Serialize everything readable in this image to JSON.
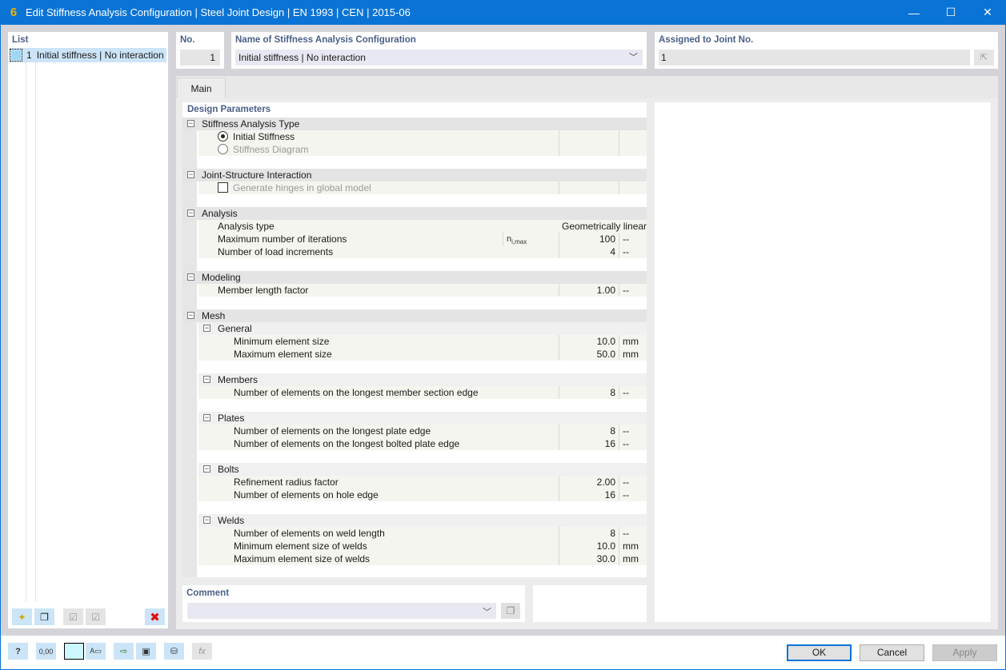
{
  "window": {
    "title": "Edit Stiffness Analysis Configuration | Steel Joint Design | EN 1993 | CEN | 2015-06",
    "app_icon": "rfem-app-icon",
    "controls": {
      "minimize": "—",
      "maximize": "☐",
      "close": "✕"
    }
  },
  "list": {
    "label": "List",
    "items": [
      {
        "number": "1",
        "name": "Initial stiffness | No interaction",
        "color": "#9fd7f3"
      }
    ],
    "toolbar": [
      {
        "name": "new-item-icon",
        "glyph": "✦",
        "enabled": true
      },
      {
        "name": "copy-item-icon",
        "glyph": "❐",
        "enabled": true
      },
      {
        "name": "check-all-icon",
        "glyph": "☑",
        "enabled": false
      },
      {
        "name": "toggle-check-icon",
        "glyph": "☑",
        "enabled": false
      },
      {
        "name": "delete-icon",
        "glyph": "✖",
        "enabled": true
      }
    ]
  },
  "header": {
    "no_label": "No.",
    "no_value": "1",
    "name_label": "Name of Stiffness Analysis Configuration",
    "name_value": "Initial stiffness | No interaction",
    "assigned_label": "Assigned to Joint No.",
    "assigned_value": "1"
  },
  "tabs": [
    {
      "label": "Main",
      "active": true
    }
  ],
  "design_parameters": {
    "title": "Design Parameters",
    "stiffness_type": {
      "label": "Stiffness Analysis Type",
      "options": [
        {
          "label": "Initial Stiffness",
          "selected": true,
          "enabled": true
        },
        {
          "label": "Stiffness Diagram",
          "selected": false,
          "enabled": false
        }
      ]
    },
    "interaction": {
      "label": "Joint-Structure Interaction",
      "checkbox": {
        "label": "Generate hinges in global model",
        "checked": false,
        "enabled": false
      }
    },
    "analysis": {
      "label": "Analysis",
      "rows": [
        {
          "label": "Analysis type",
          "symbol": "",
          "value": "Geometrically linear",
          "unit": ""
        },
        {
          "label": "Maximum number of iterations",
          "symbol": "n",
          "symbol_sub": "i,max",
          "value": "100",
          "unit": "--"
        },
        {
          "label": "Number of load increments",
          "symbol": "",
          "value": "4",
          "unit": "--"
        }
      ]
    },
    "modeling": {
      "label": "Modeling",
      "rows": [
        {
          "label": "Member length factor",
          "value": "1.00",
          "unit": "--"
        }
      ]
    },
    "mesh": {
      "label": "Mesh",
      "general": {
        "label": "General",
        "rows": [
          {
            "label": "Minimum element size",
            "value": "10.0",
            "unit": "mm"
          },
          {
            "label": "Maximum element size",
            "value": "50.0",
            "unit": "mm"
          }
        ]
      },
      "members": {
        "label": "Members",
        "rows": [
          {
            "label": "Number of elements on the longest member section edge",
            "value": "8",
            "unit": "--"
          }
        ]
      },
      "plates": {
        "label": "Plates",
        "rows": [
          {
            "label": "Number of elements on the longest plate edge",
            "value": "8",
            "unit": "--"
          },
          {
            "label": "Number of elements on the longest bolted plate edge",
            "value": "16",
            "unit": "--"
          }
        ]
      },
      "bolts": {
        "label": "Bolts",
        "rows": [
          {
            "label": "Refinement radius factor",
            "value": "2.00",
            "unit": "--"
          },
          {
            "label": "Number of elements on hole edge",
            "value": "16",
            "unit": "--"
          }
        ]
      },
      "welds": {
        "label": "Welds",
        "rows": [
          {
            "label": "Number of elements on weld length",
            "value": "8",
            "unit": "--"
          },
          {
            "label": "Minimum element size of welds",
            "value": "10.0",
            "unit": "mm"
          },
          {
            "label": "Maximum element size of welds",
            "value": "30.0",
            "unit": "mm"
          }
        ]
      }
    }
  },
  "comment": {
    "label": "Comment",
    "value": ""
  },
  "footer": {
    "tools": [
      {
        "name": "help-icon",
        "glyph": "?",
        "enabled": true
      },
      {
        "name": "units-decimals-icon",
        "glyph": "0,00",
        "enabled": true
      },
      {
        "name": "color-swatch",
        "glyph": "",
        "enabled": true
      },
      {
        "name": "display-settings-icon",
        "glyph": "A▭",
        "enabled": true
      },
      {
        "name": "import-icon",
        "glyph": "⇨",
        "enabled": true
      },
      {
        "name": "save-icon",
        "glyph": "💾",
        "enabled": true
      },
      {
        "name": "library-icon",
        "glyph": "⛁",
        "enabled": true
      },
      {
        "name": "formula-icon",
        "glyph": "fx",
        "enabled": false
      }
    ],
    "ok": "OK",
    "cancel": "Cancel",
    "apply": "Apply"
  }
}
